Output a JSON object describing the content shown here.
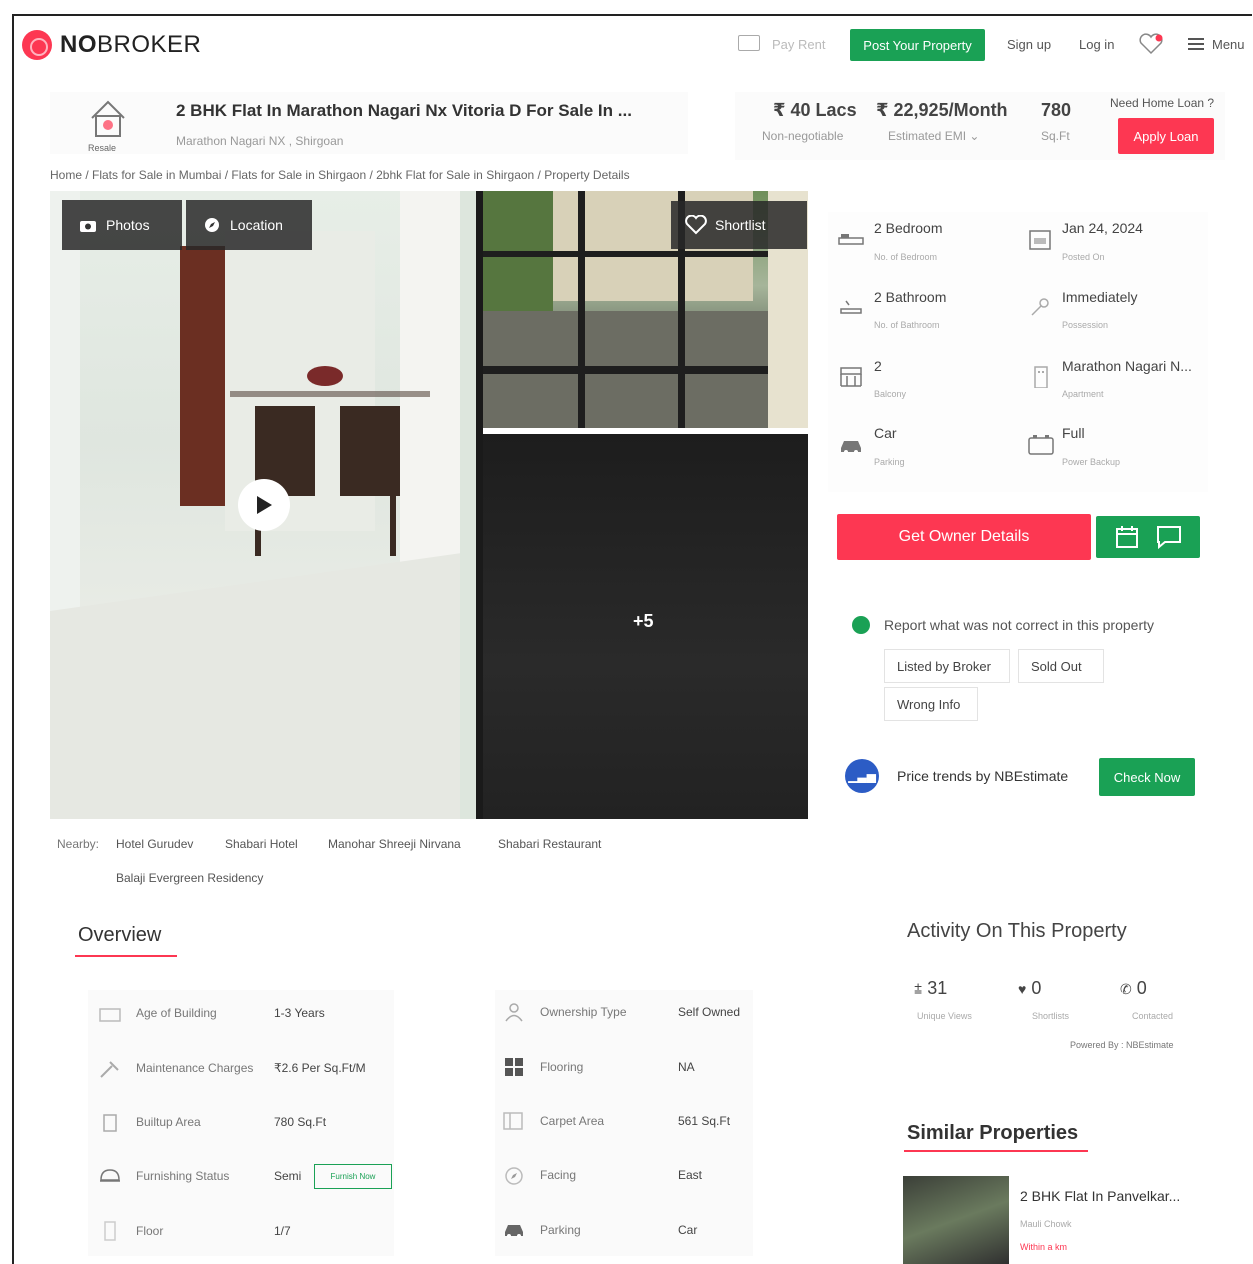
{
  "header": {
    "brand_bold": "NO",
    "brand_rest": "BROKER",
    "pay_rent": "Pay Rent",
    "post_property": "Post Your Property",
    "sign_up": "Sign up",
    "log_in": "Log in",
    "menu": "Menu"
  },
  "listing": {
    "badge": "Resale",
    "title": "2 BHK Flat In Marathon Nagari Nx Vitoria D For Sale In ...",
    "location": "Marathon Nagari NX , Shirgoan",
    "price": "₹ 40 Lacs",
    "price_note": "Non-negotiable",
    "emi": "₹ 22,925/Month",
    "emi_note": "Estimated EMI",
    "area": "780",
    "area_unit": "Sq.Ft",
    "loan_question": "Need Home Loan ?",
    "apply_loan": "Apply Loan"
  },
  "breadcrumb": "Home / Flats for Sale in Mumbai / Flats for Sale in Shirgaon / 2bhk Flat for Sale in Shirgaon / Property Details",
  "gallery": {
    "photos": "Photos",
    "location": "Location",
    "shortlist": "Shortlist",
    "more_count": "+5"
  },
  "specs": [
    {
      "value": "2 Bedroom",
      "label": "No. of Bedroom",
      "icon": "bed-icon"
    },
    {
      "value": "Jan 24, 2024",
      "label": "Posted On",
      "icon": "calendar-icon"
    },
    {
      "value": "2 Bathroom",
      "label": "No. of Bathroom",
      "icon": "bath-icon"
    },
    {
      "value": "Immediately",
      "label": "Possession",
      "icon": "key-icon"
    },
    {
      "value": "2",
      "label": "Balcony",
      "icon": "balcony-icon"
    },
    {
      "value": "Marathon Nagari N...",
      "label": "Apartment",
      "icon": "building-icon"
    },
    {
      "value": "Car",
      "label": "Parking",
      "icon": "car-icon"
    },
    {
      "value": "Full",
      "label": "Power Backup",
      "icon": "battery-icon"
    }
  ],
  "actions": {
    "owner_details": "Get Owner Details",
    "report": "Report what was not correct in this property",
    "tags": [
      "Listed by Broker",
      "Sold Out",
      "Wrong Info"
    ],
    "nbe_text": "Price trends by NBEstimate",
    "check_now": "Check Now"
  },
  "nearby": {
    "label": "Nearby:",
    "places": [
      "Hotel Gurudev",
      "Shabari Hotel",
      "Manohar Shreeji Nirvana",
      "Shabari Restaurant",
      "Balaji Evergreen Residency"
    ]
  },
  "overview": {
    "title": "Overview",
    "left": [
      {
        "label": "Age of Building",
        "value": "1-3 Years",
        "icon": "building-age-icon"
      },
      {
        "label": "Maintenance Charges",
        "value": "₹2.6 Per Sq.Ft/M",
        "icon": "tools-icon"
      },
      {
        "label": "Builtup Area",
        "value": "780 Sq.Ft",
        "icon": "area-icon"
      },
      {
        "label": "Furnishing Status",
        "value": "Semi",
        "icon": "sofa-icon"
      },
      {
        "label": "Floor",
        "value": "1/7",
        "icon": "floor-icon"
      }
    ],
    "right": [
      {
        "label": "Ownership Type",
        "value": "Self Owned",
        "icon": "ownership-icon"
      },
      {
        "label": "Flooring",
        "value": "NA",
        "icon": "tiles-icon"
      },
      {
        "label": "Carpet Area",
        "value": "561 Sq.Ft",
        "icon": "carpet-icon"
      },
      {
        "label": "Facing",
        "value": "East",
        "icon": "compass-icon"
      },
      {
        "label": "Parking",
        "value": "Car",
        "icon": "car-icon"
      }
    ],
    "furnish_now": "Furnish Now"
  },
  "activity": {
    "title": "Activity On This Property",
    "views": "31",
    "views_label": "Unique Views",
    "shortlists": "0",
    "shortlists_label": "Shortlists",
    "contacted": "0",
    "contacted_label": "Contacted",
    "powered": "Powered By : NBEstimate"
  },
  "similar": {
    "title": "Similar Properties",
    "name": "2 BHK Flat In Panvelkar...",
    "location": "Mauli Chowk",
    "distance": "Within a km"
  },
  "colors": {
    "brand_red": "#fd3752",
    "green": "#1aa155"
  }
}
